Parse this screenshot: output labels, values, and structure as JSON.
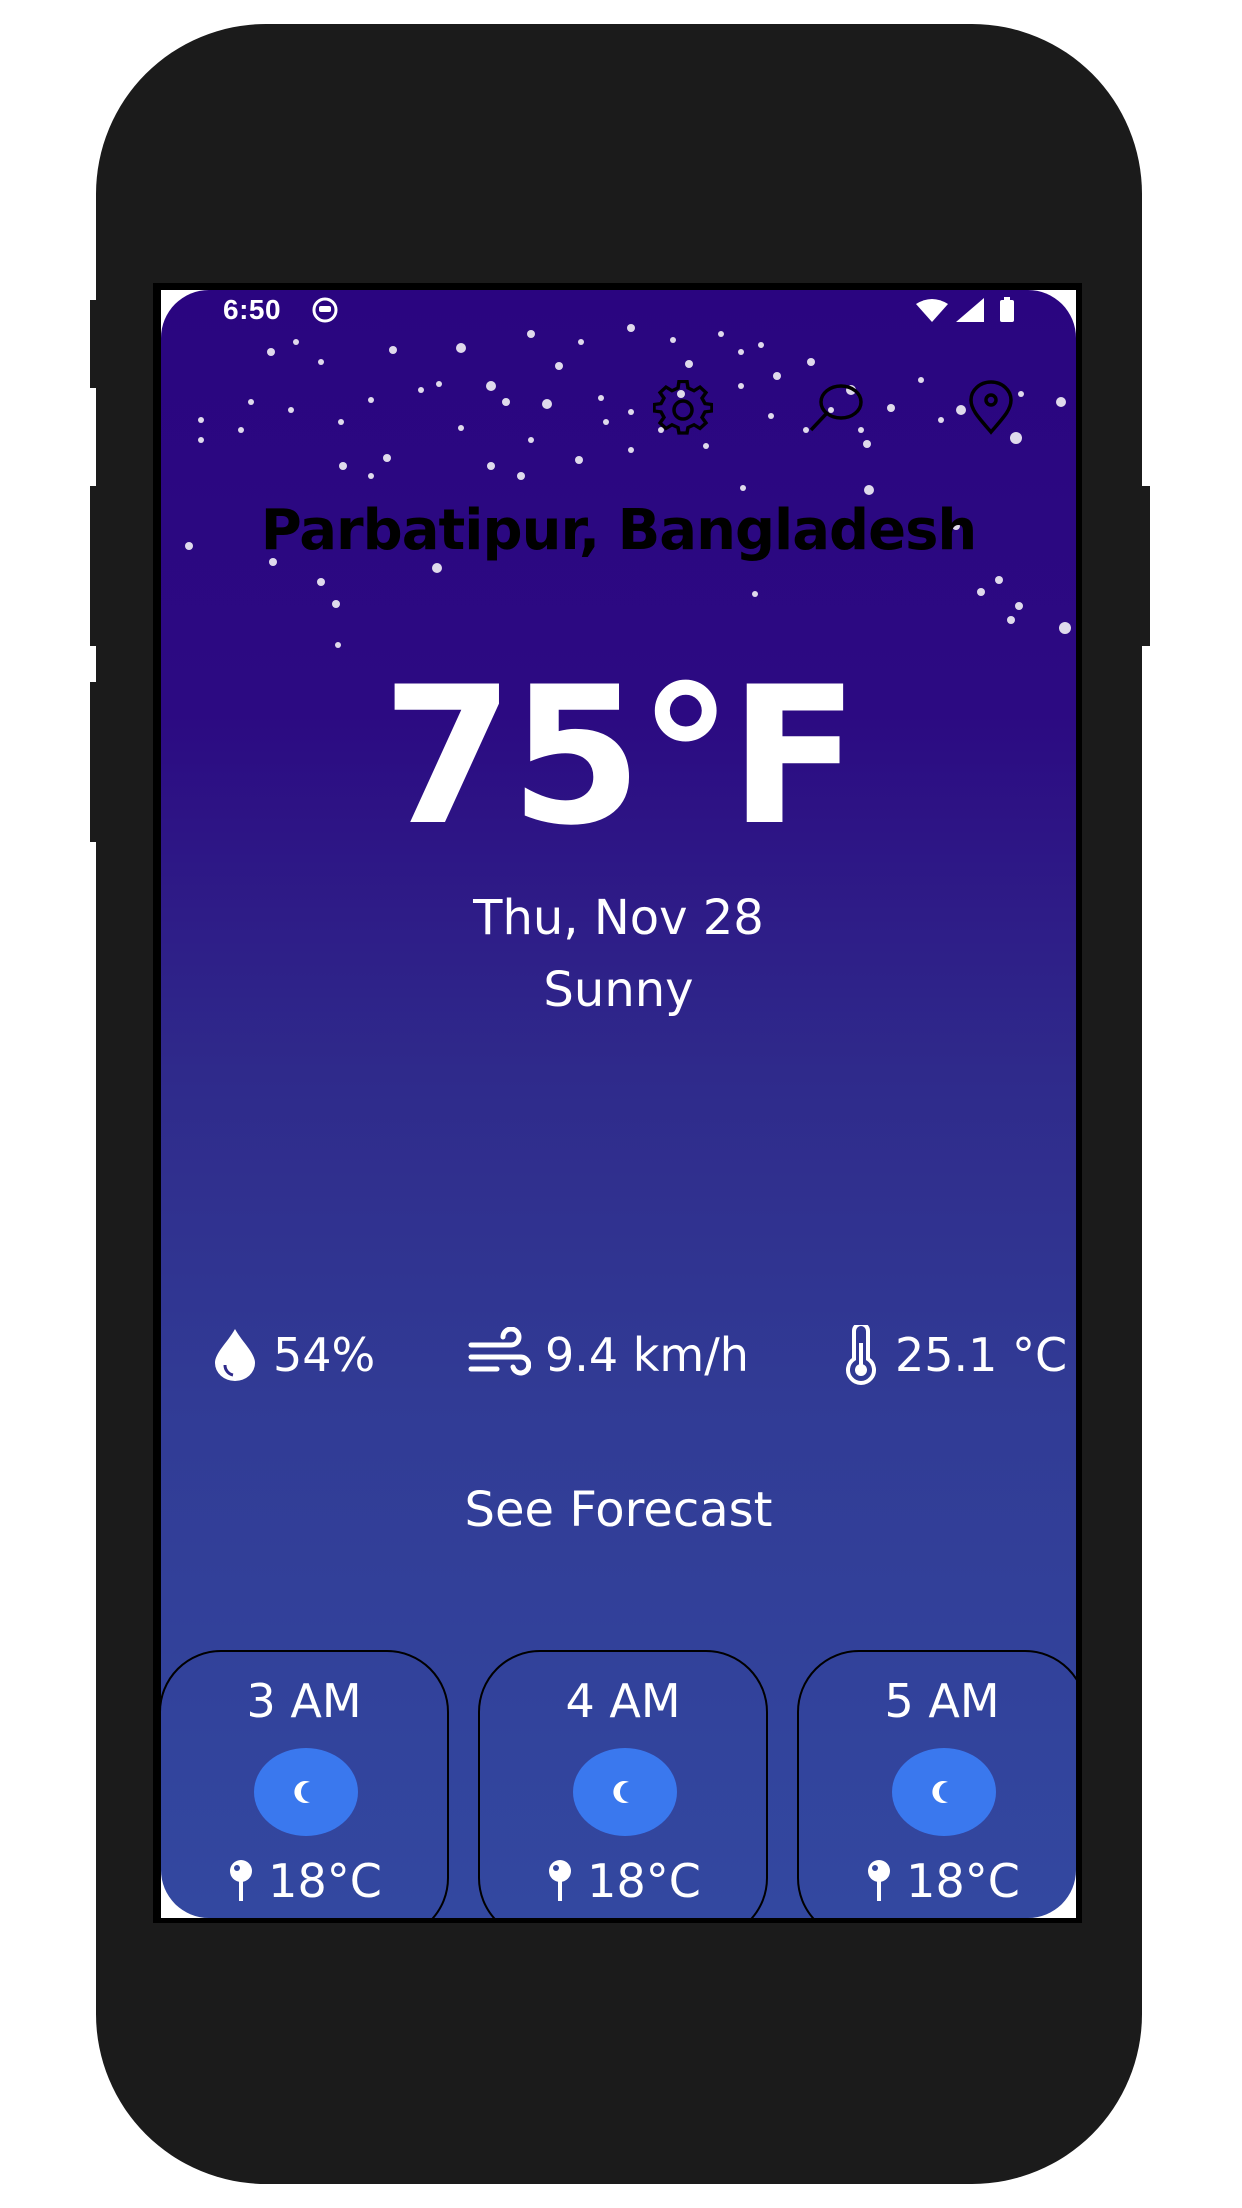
{
  "status_bar": {
    "time": "6:50"
  },
  "top_icons": {
    "settings": "gear-icon",
    "search": "search-icon",
    "location": "map-pin-icon"
  },
  "weather": {
    "location": "Parbatipur, Bangladesh",
    "temperature": "75°F",
    "date": "Thu, Nov 28",
    "condition": "Sunny"
  },
  "stats": {
    "humidity": "54%",
    "wind": "9.4 km/h",
    "feels_like": "25.1 °C"
  },
  "forecast": {
    "label": "See Forecast"
  },
  "hourly": [
    {
      "time": "3 AM",
      "temp": "18°C"
    },
    {
      "time": "4 AM",
      "temp": "18°C"
    },
    {
      "time": "5 AM",
      "temp": "18°C"
    }
  ],
  "colors": {
    "background_top": "#2a0580",
    "background_bottom": "#3348a0",
    "hour_icon_bg": "#3a78ee",
    "text": "#ffffff"
  }
}
